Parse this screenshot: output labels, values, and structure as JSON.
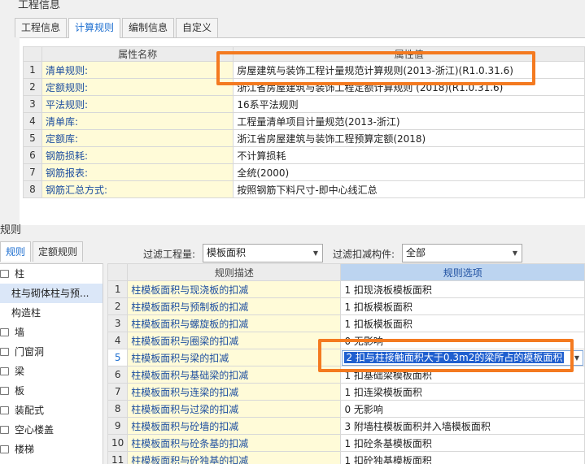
{
  "window": {
    "title": "工程信息"
  },
  "tabs": [
    {
      "label": "工程信息"
    },
    {
      "label": "计算规则"
    },
    {
      "label": "编制信息"
    },
    {
      "label": "自定义"
    }
  ],
  "rules_table": {
    "headers": {
      "name": "属性名称",
      "value": "属性值"
    },
    "rows": [
      {
        "n": "1",
        "name": "清单规则:",
        "value": "房屋建筑与装饰工程计量规范计算规则(2013-浙江)(R1.0.31.6)"
      },
      {
        "n": "2",
        "name": "定额规则:",
        "value": "浙江省房屋建筑与装饰工程定额计算规则 (2018)(R1.0.31.6)"
      },
      {
        "n": "3",
        "name": "平法规则:",
        "value": "16系平法规则"
      },
      {
        "n": "4",
        "name": "清单库:",
        "value": "工程量清单项目计量规范(2013-浙江)"
      },
      {
        "n": "5",
        "name": "定额库:",
        "value": "浙江省房屋建筑与装饰工程预算定额(2018)"
      },
      {
        "n": "6",
        "name": "钢筋损耗:",
        "value": "不计算损耗"
      },
      {
        "n": "7",
        "name": "钢筋报表:",
        "value": "全统(2000)"
      },
      {
        "n": "8",
        "name": "钢筋汇总方式:",
        "value": "按照钢筋下料尺寸-即中心线汇总"
      }
    ]
  },
  "lower": {
    "title": "规则",
    "tabs": [
      {
        "label": "规则"
      },
      {
        "label": "定额规则"
      }
    ],
    "filter_quantity_label": "过滤工程量:",
    "filter_quantity_value": "模板面积",
    "filter_deduct_label": "过滤扣减构件:",
    "filter_deduct_value": "全部",
    "tree": [
      {
        "label": "柱",
        "folder": true
      },
      {
        "label": "柱与砌体柱与预...",
        "folder": false,
        "selected": true
      },
      {
        "label": "构造柱",
        "folder": false
      },
      {
        "label": "墙",
        "folder": true
      },
      {
        "label": "门窗洞",
        "folder": true
      },
      {
        "label": "梁",
        "folder": true
      },
      {
        "label": "板",
        "folder": true
      },
      {
        "label": "装配式",
        "folder": true
      },
      {
        "label": "空心楼盖",
        "folder": true
      },
      {
        "label": "楼梯",
        "folder": true
      }
    ],
    "grid": {
      "headers": {
        "desc": "规则描述",
        "option": "规则选项"
      },
      "rows": [
        {
          "n": "1",
          "desc": "柱模板面积与现浇板的扣减",
          "option": "1  扣现浇板模板面积"
        },
        {
          "n": "2",
          "desc": "柱模板面积与预制板的扣减",
          "option": "1  扣板模板面积"
        },
        {
          "n": "3",
          "desc": "柱模板面积与螺旋板的扣减",
          "option": "1  扣板模板面积"
        },
        {
          "n": "4",
          "desc": "柱模板面积与圈梁的扣减",
          "option": "0  无影响"
        },
        {
          "n": "5",
          "desc": "柱模板面积与梁的扣减",
          "option": "2 扣与柱接触面积大于0.3m2的梁所占的模板面积"
        },
        {
          "n": "6",
          "desc": "柱模板面积与基础梁的扣减",
          "option": "1  扣基础梁模板面积"
        },
        {
          "n": "7",
          "desc": "柱模板面积与连梁的扣减",
          "option": "1  扣连梁模板面积"
        },
        {
          "n": "8",
          "desc": "柱模板面积与过梁的扣减",
          "option": "0  无影响"
        },
        {
          "n": "9",
          "desc": "柱模板面积与砼墙的扣减",
          "option": "3  附墙柱模板面积并入墙模板面积"
        },
        {
          "n": "10",
          "desc": "柱模板面积与砼条基的扣减",
          "option": "1  扣砼条基模板面积"
        },
        {
          "n": "11",
          "desc": "柱模板面积与砼独基的扣减",
          "option": "1  扣砼独基模板面积"
        }
      ]
    }
  },
  "colors": {
    "annotation": "#f47a20",
    "selection": "#1f5fcf",
    "name_cell": "#fffbd8"
  }
}
